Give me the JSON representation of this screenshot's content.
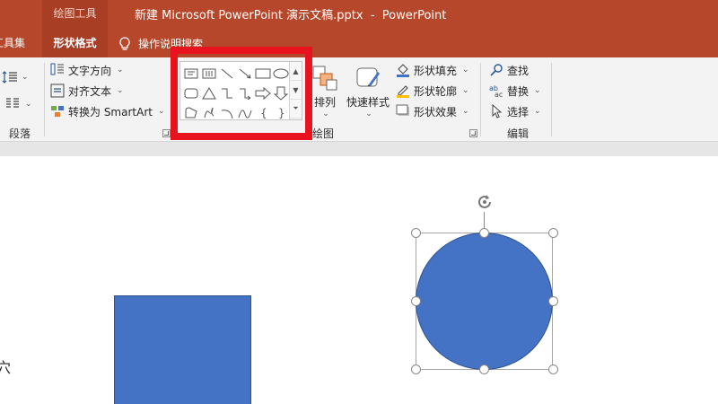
{
  "titlebar": {
    "context_group": "绘图工具",
    "title": "新建 Microsoft PowerPoint 演示文稿.pptx  -  PowerPoint",
    "tabs": {
      "partial_left": "工具集",
      "active": "形状格式",
      "tell_me": "操作说明搜索"
    }
  },
  "ribbon": {
    "paragraph": {
      "label": "段落"
    },
    "text_group": {
      "text_direction": "文字方向",
      "align_text": "对齐文本",
      "convert_smartart": "转换为 SmartArt"
    },
    "drawing": {
      "label": "绘图",
      "arrange": "排列",
      "quick_styles": "快速样式",
      "shape_fill": "形状填充",
      "shape_outline": "形状轮廓",
      "shape_effects": "形状效果"
    },
    "editing": {
      "label": "编辑",
      "find": "查找",
      "replace": "替换",
      "select": "选择"
    }
  },
  "slide": {
    "edge_char": "穴"
  },
  "colors": {
    "titlebar": "#b7472a",
    "shape_fill": "#4472c4",
    "highlight": "#e8131f"
  }
}
